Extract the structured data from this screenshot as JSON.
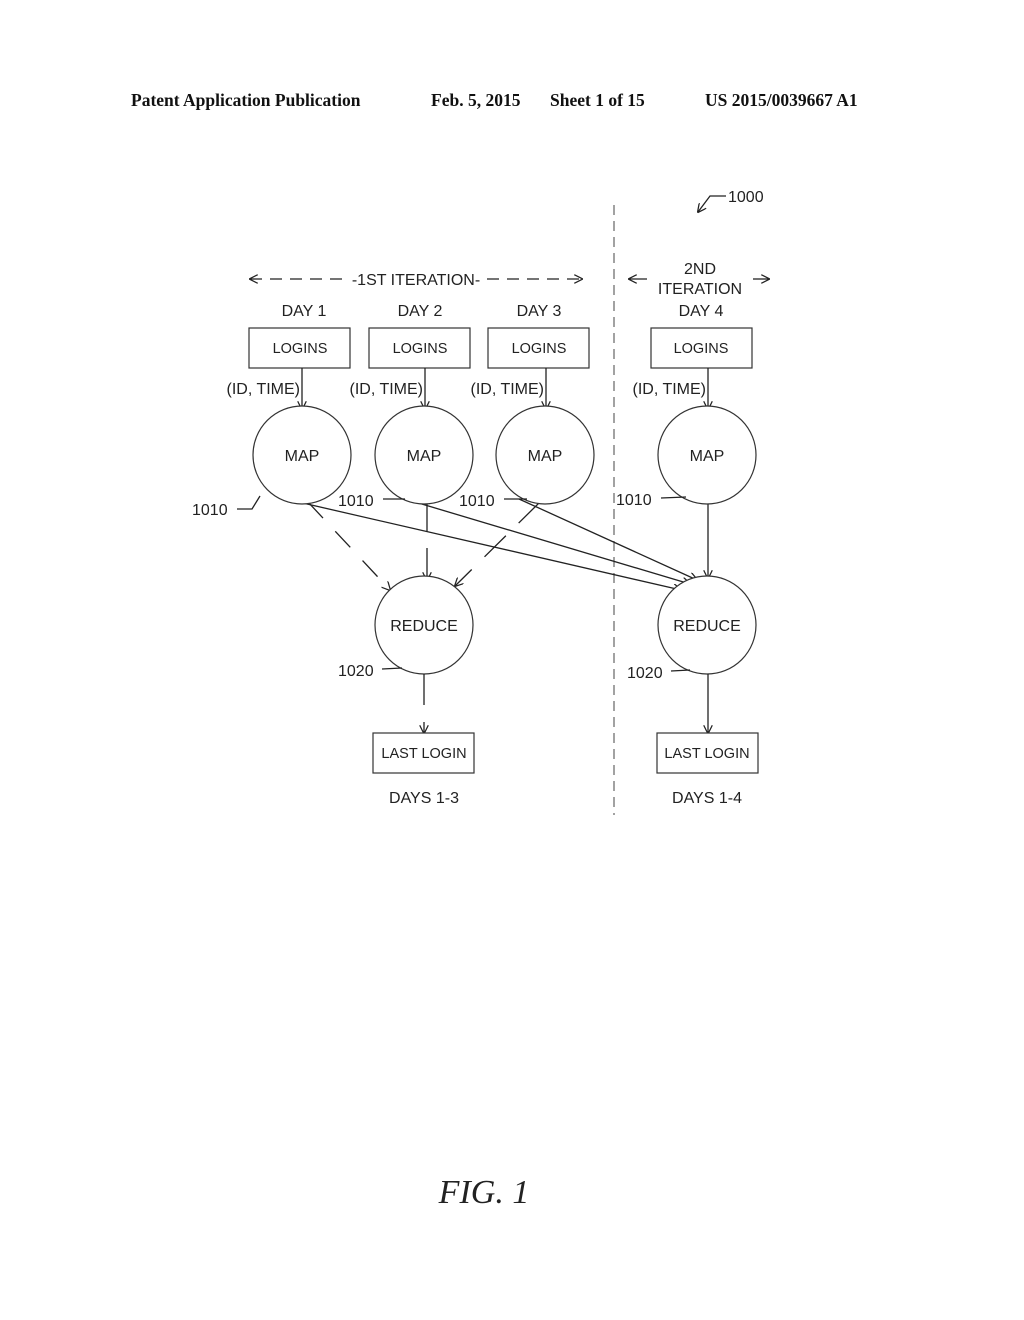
{
  "header": {
    "publication": "Patent Application Publication",
    "date": "Feb. 5, 2015",
    "sheet": "Sheet 1 of 15",
    "number": "US 2015/0039667 A1"
  },
  "figure": {
    "ref": "1000",
    "caption": "FIG. 1",
    "iteration1_label": "-1ST ITERATION-",
    "iteration2_label_line1": "2ND",
    "iteration2_label_line2": "ITERATION",
    "days": [
      "DAY 1",
      "DAY 2",
      "DAY 3",
      "DAY 4"
    ],
    "input_box_label": "LOGINS",
    "edge_label": "(ID, TIME)",
    "map_label": "MAP",
    "map_ref": "1010",
    "reduce_label": "REDUCE",
    "reduce_ref": "1020",
    "output_box_label": "LAST LOGIN",
    "outputs": [
      "DAYS 1-3",
      "DAYS 1-4"
    ]
  }
}
